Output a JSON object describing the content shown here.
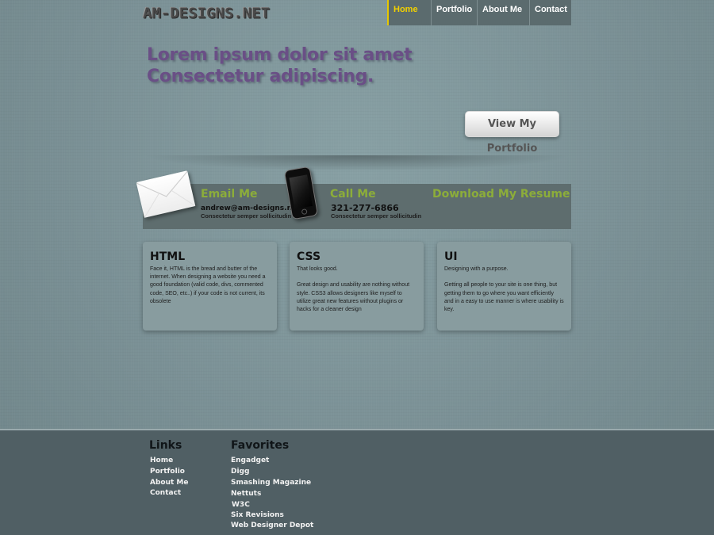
{
  "logo": {
    "text": "AM-DESIGNS.NET"
  },
  "nav": {
    "items": [
      {
        "label": "Home",
        "active": true
      },
      {
        "label": "Portfolio"
      },
      {
        "label": "About Me"
      },
      {
        "label": "Contact"
      }
    ]
  },
  "hero": {
    "line1": "Lorem ipsum dolor sit amet",
    "line2": "Consectetur adipiscing.",
    "button_label": "View My Portfolio",
    "heading_color": "#6a4f86"
  },
  "contact": {
    "email": {
      "title": "Email Me",
      "detail": "andrew@am-designs.net",
      "sub": "Consectetur semper sollicitudin"
    },
    "call": {
      "title": "Call Me",
      "detail": "321-277-6866",
      "sub": "Consectetur semper sollicitudin"
    },
    "resume": {
      "title": "Download My Resume"
    },
    "accent_color": "#8cad3a"
  },
  "cards": [
    {
      "title": "HTML",
      "text": "Face it, HTML is the bread and butter of the internet. When designing a website you need a good foundation (valid code, divs, commented code, SEO, etc..) if your code is not current, its obsolete"
    },
    {
      "title": "CSS",
      "text": "That looks good.\n\nGreat design and usability are nothing without style. CSS3 allows designers like myself to utilize great new features without plugins or hacks for a cleaner design"
    },
    {
      "title": "UI",
      "text": "Designing with a purpose.\n\nGetting all people to your site is one thing, but getting them to go where you want efficiently and in a easy to use manner is where usability is key."
    }
  ],
  "footer": {
    "links_heading": "Links",
    "links": [
      "Home",
      "Portfolio",
      "About Me",
      "Contact"
    ],
    "favorites_heading": "Favorites",
    "favorites": [
      "Engadget",
      "Digg",
      "Smashing Magazine",
      "Nettuts",
      "W3C",
      "Six Revisions",
      "Web Designer Depot"
    ]
  },
  "icons": [
    "envelope-icon",
    "phone-icon"
  ]
}
